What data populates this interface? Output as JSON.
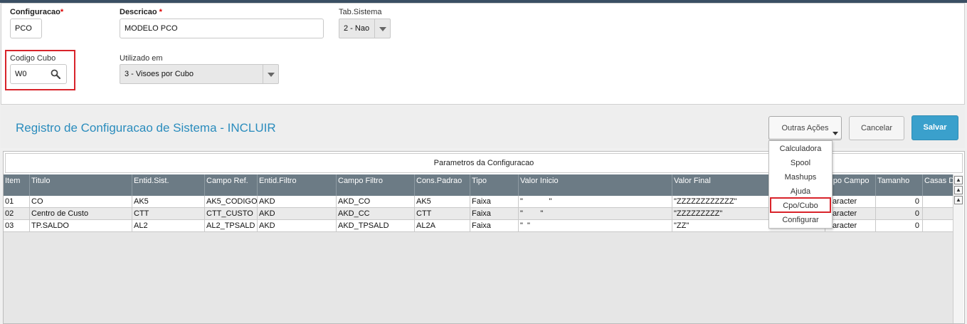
{
  "form": {
    "configuracao": {
      "label": "Configuracao",
      "required_mark": "*",
      "value": "PCO"
    },
    "descricao": {
      "label": "Descricao ",
      "required_mark": "*",
      "value": "MODELO PCO"
    },
    "tab_sistema": {
      "label": "Tab.Sistema",
      "value": "2 - Nao"
    },
    "codigo_cubo": {
      "label": "Codigo Cubo",
      "value": "W0"
    },
    "utilizado_em": {
      "label": "Utilizado em",
      "value": "3 - Visoes por Cubo"
    }
  },
  "header": {
    "title": "Registro de Configuracao de Sistema - INCLUIR",
    "outras_acoes": "Outras Ações",
    "cancelar": "Cancelar",
    "salvar": "Salvar"
  },
  "grid": {
    "caption": "Parametros da Configuracao",
    "columns": [
      "Item",
      "Titulo",
      "Entid.Sist.",
      "Campo Ref.",
      "Entid.Filtro",
      "Campo Filtro",
      "Cons.Padrao",
      "Tipo",
      "Valor Inicio",
      "Valor Final",
      "Tipo Campo",
      "Tamanho",
      "Casas D"
    ],
    "rows": [
      [
        "01",
        "CO",
        "AK5",
        "AK5_CODIGO",
        "AKD",
        "AKD_CO",
        "AK5",
        "Faixa",
        "\"            \"",
        "\"ZZZZZZZZZZZZ\"",
        "Caracter",
        "0",
        ""
      ],
      [
        "02",
        "Centro de Custo",
        "CTT",
        "CTT_CUSTO",
        "AKD",
        "AKD_CC",
        "CTT",
        "Faixa",
        "\"        \"",
        "\"ZZZZZZZZZ\"",
        "Caracter",
        "0",
        ""
      ],
      [
        "03",
        "TP.SALDO",
        "AL2",
        "AL2_TPSALD",
        "AKD",
        "AKD_TPSALD",
        "AL2A",
        "Faixa",
        "\"  \"",
        "\"ZZ\"",
        "Caracter",
        "0",
        ""
      ]
    ]
  },
  "menu": {
    "items": [
      "Calculadora",
      "Spool",
      "Mashups",
      "Ajuda",
      "Cpo/Cubo",
      "Configurar"
    ],
    "highlighted": "Cpo/Cubo"
  },
  "colors": {
    "accent": "#2a8cbd",
    "primary_button": "#3aa0cc",
    "highlight": "#d8232a",
    "grid_header": "#6c7b85"
  }
}
